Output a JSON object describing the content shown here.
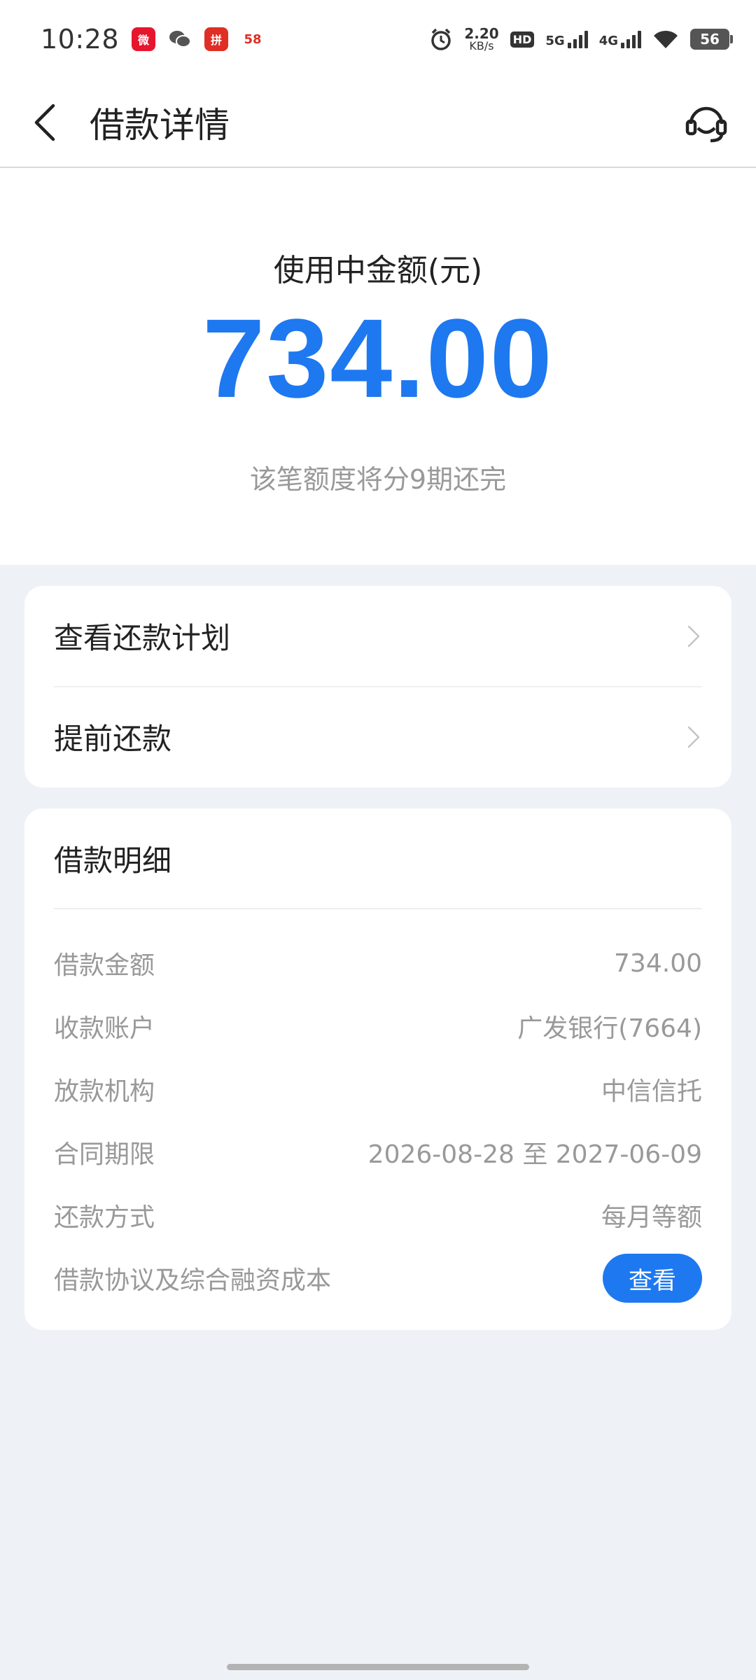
{
  "status_bar": {
    "time": "10:28",
    "net_speed_value": "2.20",
    "net_speed_unit": "KB/s",
    "hd_label": "HD",
    "sim1_label": "5G",
    "sim2_label": "4G",
    "battery": "56",
    "app_badges": [
      {
        "name": "weibo",
        "color": "#e6162d"
      },
      {
        "name": "wechat",
        "color": "#5a5a5a"
      },
      {
        "name": "pinduoduo",
        "color": "#e02e24"
      },
      {
        "name": "58",
        "color": "#f5a623"
      }
    ]
  },
  "header": {
    "title": "借款详情"
  },
  "hero": {
    "label": "使用中金额(元)",
    "amount": "734.00",
    "note": "该笔额度将分9期还完"
  },
  "menu": {
    "items": [
      {
        "label": "查看还款计划"
      },
      {
        "label": "提前还款"
      }
    ]
  },
  "detail": {
    "title": "借款明细",
    "rows": [
      {
        "label": "借款金额",
        "value": "734.00"
      },
      {
        "label": "收款账户",
        "value": "广发银行(7664)"
      },
      {
        "label": "放款机构",
        "value": "中信信托"
      },
      {
        "label": "合同期限",
        "value": "2026-08-28 至 2027-06-09"
      },
      {
        "label": "还款方式",
        "value": "每月等额"
      }
    ],
    "agreement_label": "借款协议及综合融资成本",
    "agreement_button": "查看"
  },
  "colors": {
    "accent": "#1e78f0",
    "background": "#eef1f6"
  }
}
